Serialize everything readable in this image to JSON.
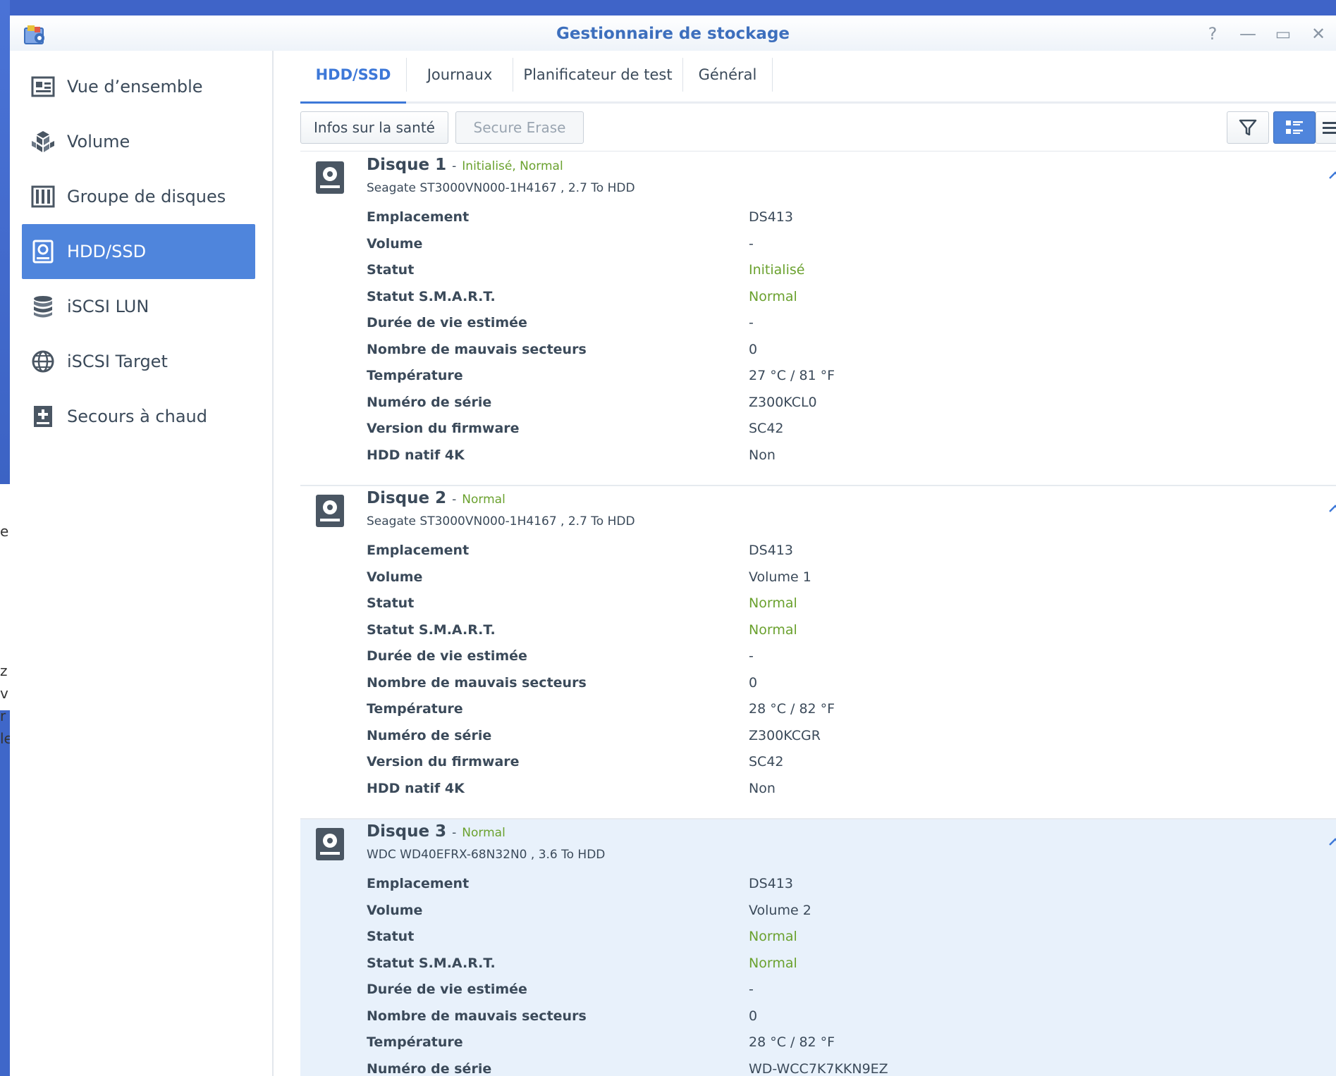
{
  "window": {
    "title": "Gestionnaire de stockage"
  },
  "window_controls": {
    "help": "?",
    "minimize": "—",
    "maximize": "▭",
    "close": "✕"
  },
  "desktop_fragments": [
    "e",
    "z",
    "v",
    "r",
    "le"
  ],
  "sidebar": {
    "items": [
      {
        "label": "Vue d’ensemble",
        "icon": "overview-icon"
      },
      {
        "label": "Volume",
        "icon": "volume-icon"
      },
      {
        "label": "Groupe de disques",
        "icon": "disk-group-icon"
      },
      {
        "label": "HDD/SSD",
        "icon": "hdd-icon",
        "active": true
      },
      {
        "label": "iSCSI LUN",
        "icon": "database-icon"
      },
      {
        "label": "iSCSI Target",
        "icon": "globe-icon"
      },
      {
        "label": "Secours à chaud",
        "icon": "hot-spare-icon"
      }
    ]
  },
  "tabs": [
    {
      "label": "HDD/SSD",
      "active": true
    },
    {
      "label": "Journaux"
    },
    {
      "label": "Planificateur de test"
    },
    {
      "label": "Général"
    }
  ],
  "toolbar": {
    "health_info": "Infos sur la santé",
    "secure_erase": "Secure Erase",
    "filter_icon": "filter-icon",
    "detail_view_icon": "detail-view-icon",
    "list_view_icon": "list-view-icon"
  },
  "colors": {
    "accent": "#4f85dc",
    "status_ok": "#6aa12e",
    "selected_bg": "#e8f1fb"
  },
  "disks": [
    {
      "name": "Disque 1",
      "sep": "-",
      "status": "Initialisé, Normal",
      "model": "Seagate ST3000VN000-1H4167 , 2.7 To HDD",
      "props": [
        {
          "key": "Emplacement",
          "value": "DS413"
        },
        {
          "key": "Volume",
          "value": "-"
        },
        {
          "key": "Statut",
          "value": "Initialisé"
        },
        {
          "key": "Statut S.M.A.R.T.",
          "value": "Normal"
        },
        {
          "key": "Durée de vie estimée",
          "value": "-"
        },
        {
          "key": "Nombre de mauvais secteurs",
          "value": "0"
        },
        {
          "key": "Température",
          "value": "27 °C / 81 °F"
        },
        {
          "key": "Numéro de série",
          "value": "Z300KCL0"
        },
        {
          "key": "Version du firmware",
          "value": "SC42"
        },
        {
          "key": "HDD natif 4K",
          "value": "Non"
        }
      ]
    },
    {
      "name": "Disque 2",
      "sep": "-",
      "status": "Normal",
      "model": "Seagate ST3000VN000-1H4167 , 2.7 To HDD",
      "props": [
        {
          "key": "Emplacement",
          "value": "DS413"
        },
        {
          "key": "Volume",
          "value": "Volume 1"
        },
        {
          "key": "Statut",
          "value": "Normal"
        },
        {
          "key": "Statut S.M.A.R.T.",
          "value": "Normal"
        },
        {
          "key": "Durée de vie estimée",
          "value": "-"
        },
        {
          "key": "Nombre de mauvais secteurs",
          "value": "0"
        },
        {
          "key": "Température",
          "value": "28 °C / 82 °F"
        },
        {
          "key": "Numéro de série",
          "value": "Z300KCGR"
        },
        {
          "key": "Version du firmware",
          "value": "SC42"
        },
        {
          "key": "HDD natif 4K",
          "value": "Non"
        }
      ]
    },
    {
      "name": "Disque 3",
      "sep": "-",
      "status": "Normal",
      "model": "WDC WD40EFRX-68N32N0 , 3.6 To HDD",
      "props": [
        {
          "key": "Emplacement",
          "value": "DS413"
        },
        {
          "key": "Volume",
          "value": "Volume 2"
        },
        {
          "key": "Statut",
          "value": "Normal"
        },
        {
          "key": "Statut S.M.A.R.T.",
          "value": "Normal"
        },
        {
          "key": "Durée de vie estimée",
          "value": "-"
        },
        {
          "key": "Nombre de mauvais secteurs",
          "value": "0"
        },
        {
          "key": "Température",
          "value": "28 °C / 82 °F"
        },
        {
          "key": "Numéro de série",
          "value": "WD-WCC7K7KKN9EZ"
        }
      ]
    }
  ]
}
